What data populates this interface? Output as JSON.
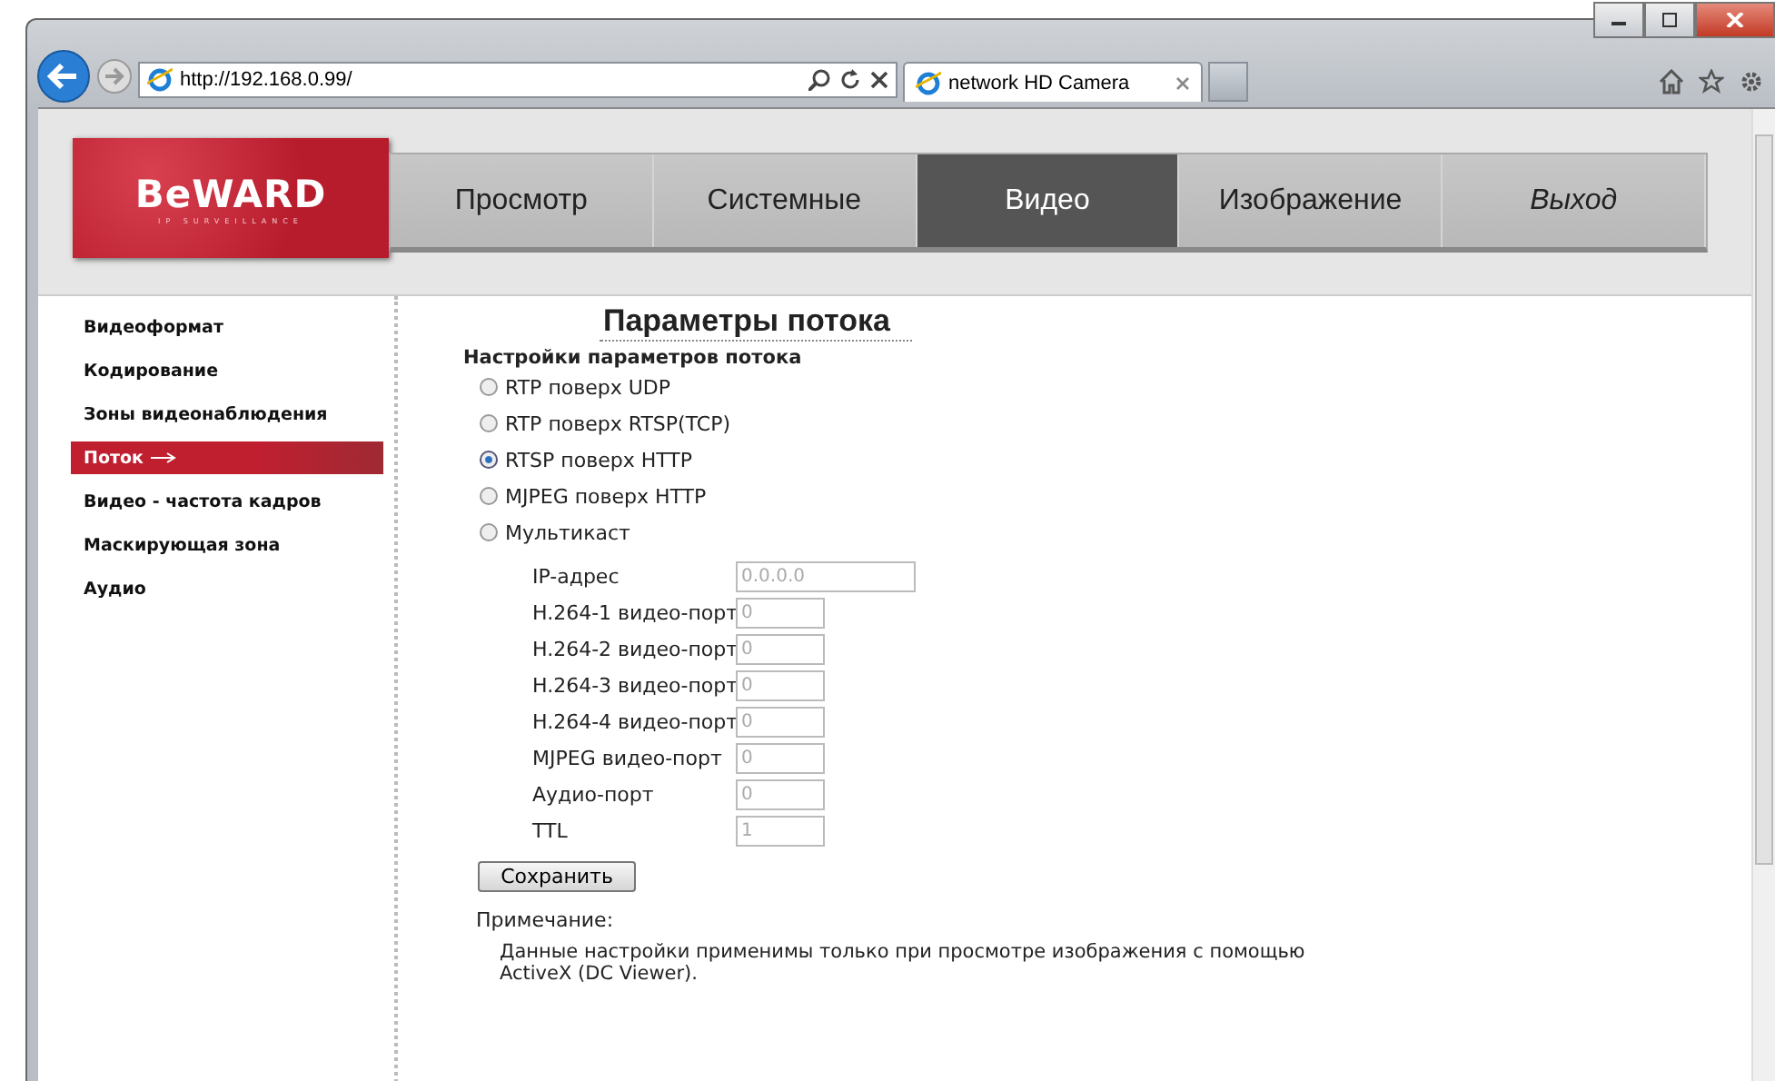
{
  "browser": {
    "address": "http://192.168.0.99/",
    "tabs": [
      {
        "label": "network HD Camera",
        "selected": true
      }
    ]
  },
  "logo": {
    "brand": "BeWARD",
    "tagline": "IP SURVEILLANCE"
  },
  "nav": [
    {
      "label": "Просмотр",
      "selected": false,
      "kind": "link"
    },
    {
      "label": "Системные",
      "selected": false,
      "kind": "link"
    },
    {
      "label": "Видео",
      "selected": true,
      "kind": "link"
    },
    {
      "label": "Изображение",
      "selected": false,
      "kind": "link"
    },
    {
      "label": "Выход",
      "selected": false,
      "kind": "exit"
    }
  ],
  "sidebar": {
    "items": [
      {
        "label": "Видеоформат",
        "selected": false
      },
      {
        "label": "Кодирование",
        "selected": false
      },
      {
        "label": "Зоны видеонаблюдения",
        "selected": false
      },
      {
        "label": "Поток",
        "selected": true
      },
      {
        "label": "Видео - частота кадров",
        "selected": false
      },
      {
        "label": "Маскирующая зона",
        "selected": false
      },
      {
        "label": "Аудио",
        "selected": false
      }
    ]
  },
  "page_title": "Параметры потока",
  "section_title": "Настройки параметров потока",
  "stream_modes": [
    {
      "label": "RTP поверх UDP",
      "selected": false
    },
    {
      "label": "RTP поверх RTSP(TCP)",
      "selected": false
    },
    {
      "label": "RTSP поверх HTTP",
      "selected": true
    },
    {
      "label": "MJPEG поверх HTTP",
      "selected": false
    },
    {
      "label": "Мультикаст",
      "selected": false
    }
  ],
  "multicast_fields": [
    {
      "label": "IP-адрес",
      "value": "0.0.0.0",
      "kind": "address",
      "disabled": true
    },
    {
      "label": "H.264-1 видео-порт",
      "value": "0",
      "kind": "port",
      "disabled": true
    },
    {
      "label": "H.264-2 видео-порт",
      "value": "0",
      "kind": "port",
      "disabled": true
    },
    {
      "label": "H.264-3 видео-порт",
      "value": "0",
      "kind": "port",
      "disabled": true
    },
    {
      "label": "H.264-4 видео-порт",
      "value": "0",
      "kind": "port",
      "disabled": true
    },
    {
      "label": "MJPEG видео-порт",
      "value": "0",
      "kind": "port",
      "disabled": true
    },
    {
      "label": "Аудио-порт",
      "value": "0",
      "kind": "port",
      "disabled": true
    },
    {
      "label": "TTL",
      "value": "1",
      "kind": "port",
      "disabled": true
    }
  ],
  "save_button": "Сохранить",
  "note": {
    "title": "Примечание:",
    "text": "Данные настройки применимы только при просмотре изображения с помощью ActiveX (DC Viewer)."
  }
}
